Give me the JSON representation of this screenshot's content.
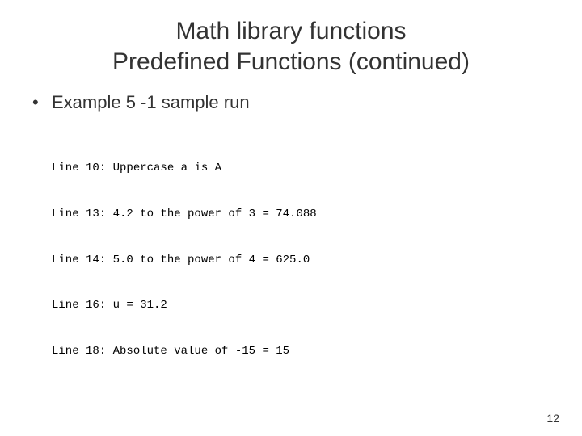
{
  "title_line1": "Math library functions",
  "title_line2": "Predefined Functions (continued)",
  "bullet": "Example 5 -1 sample run",
  "code_lines": [
    "Line 10: Uppercase a is A",
    "Line 13: 4.2 to the power of 3 = 74.088",
    "Line 14: 5.0 to the power of 4 = 625.0",
    "Line 16: u = 31.2",
    "Line 18: Absolute value of -15 = 15"
  ],
  "page_number": "12"
}
